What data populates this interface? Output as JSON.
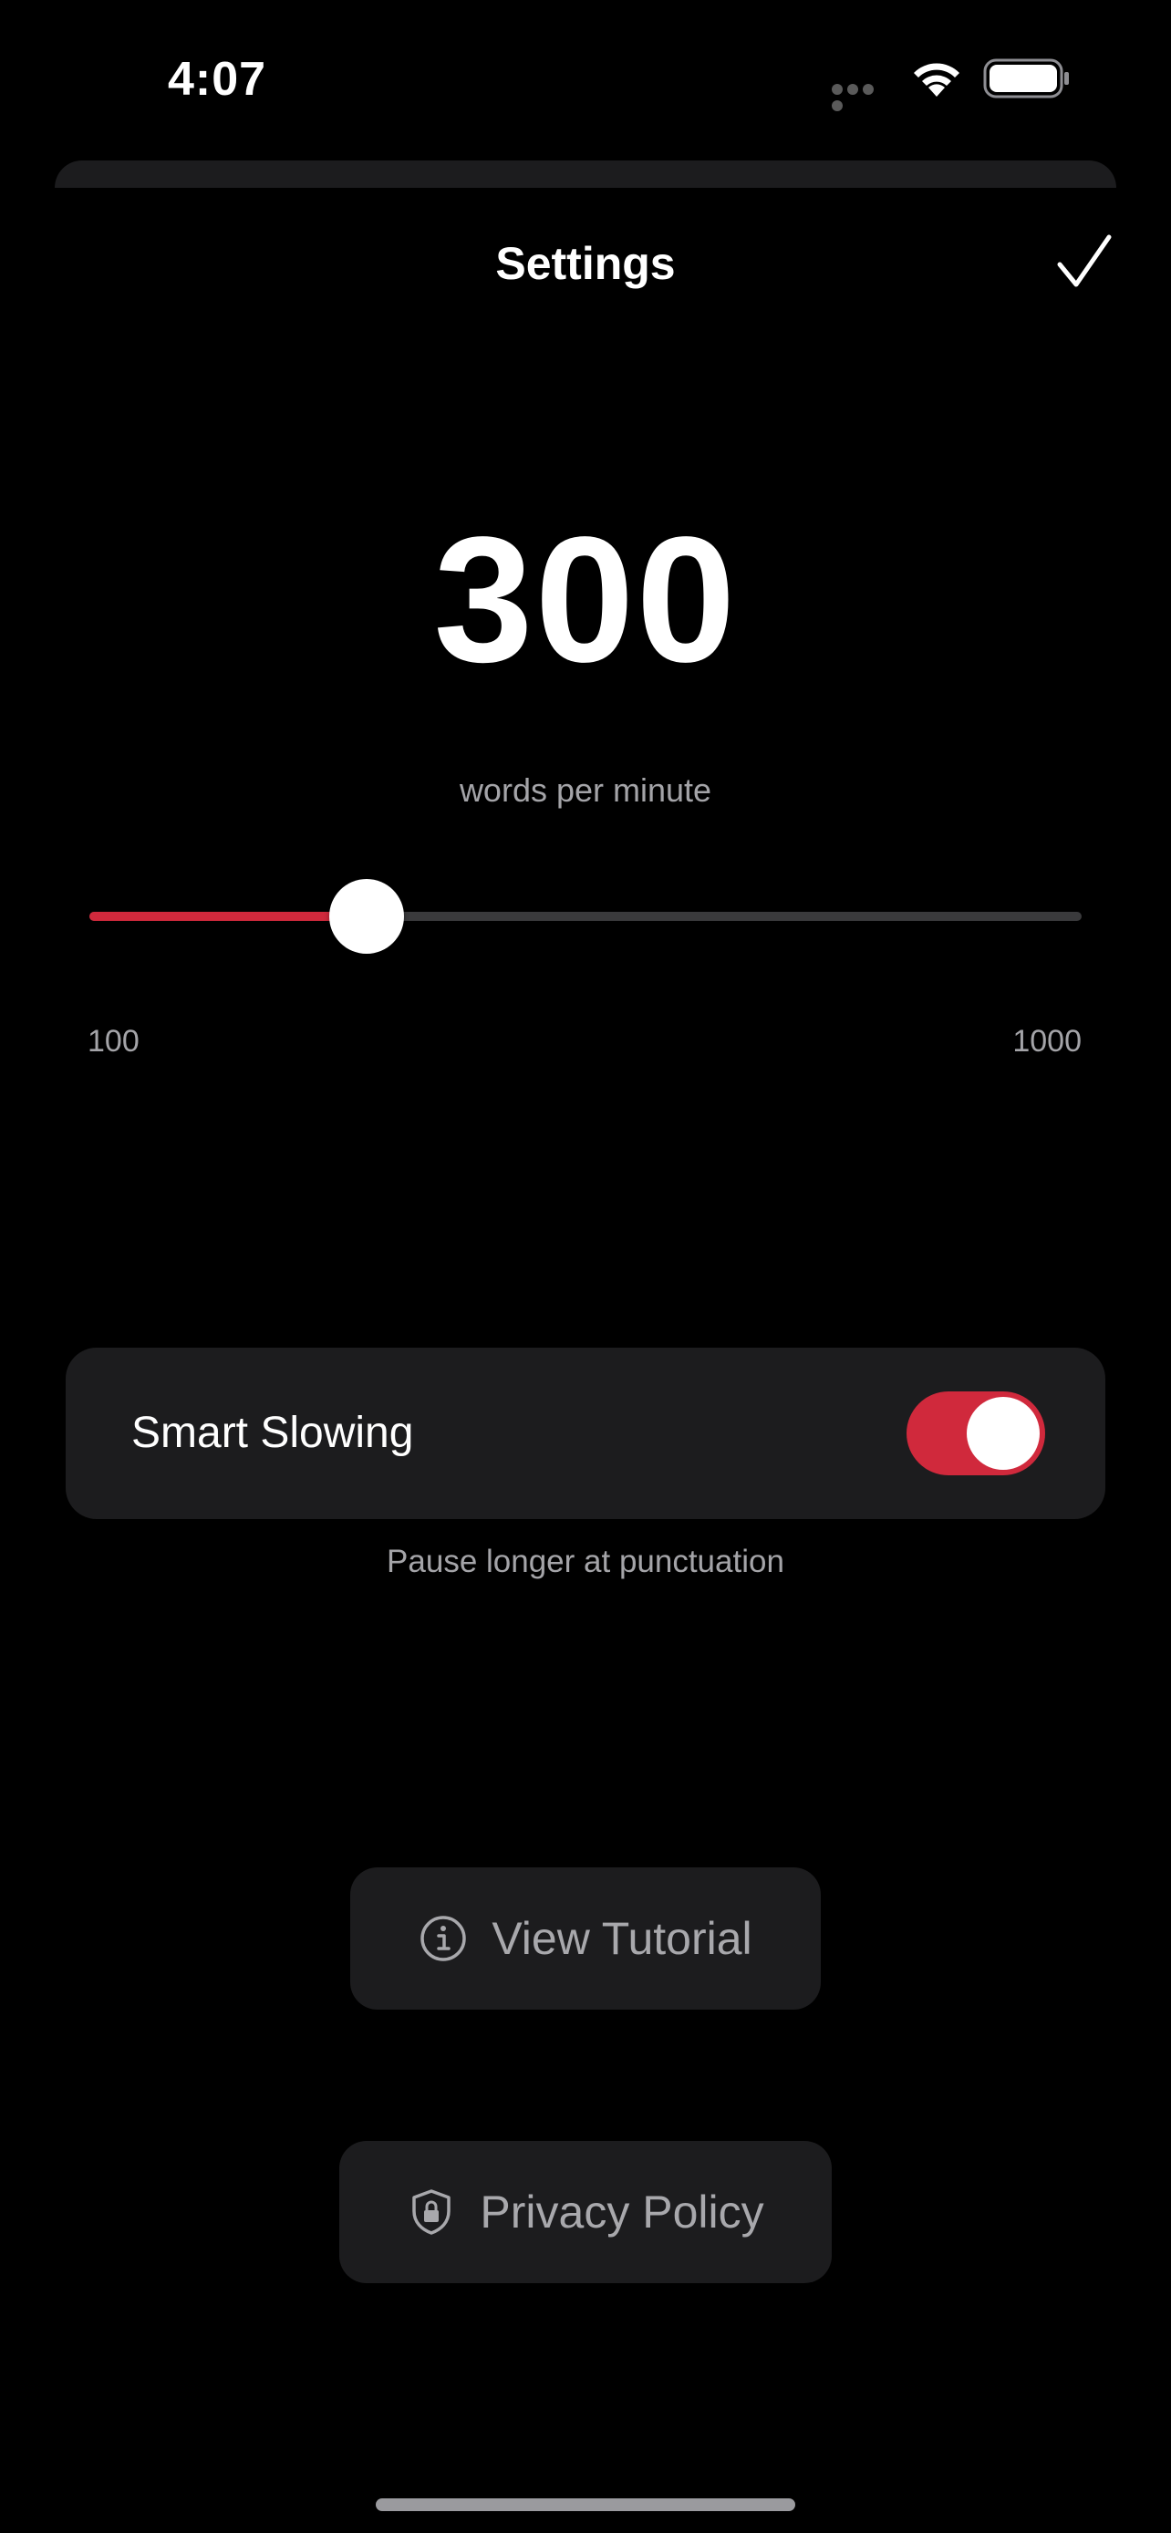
{
  "status_bar": {
    "time": "4:07",
    "icons": [
      "signal-icon",
      "wifi-icon",
      "battery-icon"
    ]
  },
  "nav": {
    "title": "Settings",
    "done_icon": "checkmark-icon"
  },
  "speed": {
    "value": "300",
    "unit": "words per minute",
    "slider": {
      "min_label": "100",
      "max_label": "1000",
      "min": 100,
      "max": 1000,
      "value": 300
    }
  },
  "smart_slowing": {
    "label": "Smart Slowing",
    "enabled": true,
    "caption": "Pause longer at punctuation"
  },
  "buttons": {
    "tutorial": {
      "label": "View Tutorial",
      "icon": "info-icon"
    },
    "privacy": {
      "label": "Privacy Policy",
      "icon": "shield-lock-icon"
    }
  },
  "colors": {
    "background": "#000000",
    "accent": "#d0293c",
    "surface": "#1c1c1e",
    "secondary_text": "#a4a4a8"
  }
}
